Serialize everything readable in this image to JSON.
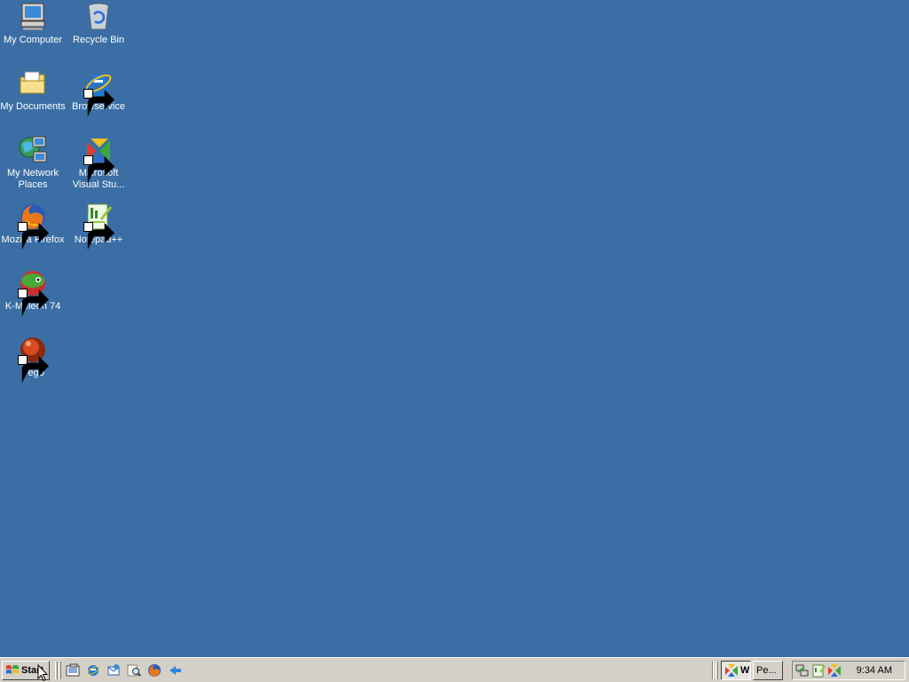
{
  "desktop": {
    "background_color": "#3a6ea5",
    "icons": [
      {
        "name": "my-computer",
        "label": "My Computer",
        "icon": "computer-icon",
        "shortcut": false
      },
      {
        "name": "recycle-bin",
        "label": "Recycle Bin",
        "icon": "recycle-bin-icon",
        "shortcut": false
      },
      {
        "name": "my-documents",
        "label": "My Documents",
        "icon": "folder-icon",
        "shortcut": false
      },
      {
        "name": "browservice",
        "label": "Browservice",
        "icon": "internet-explorer-icon",
        "shortcut": true
      },
      {
        "name": "my-network-places",
        "label": "My Network Places",
        "icon": "network-icon",
        "shortcut": false
      },
      {
        "name": "microsoft-visual-studio",
        "label": "Microsoft Visual Stu...",
        "icon": "visual-studio-icon",
        "shortcut": true
      },
      {
        "name": "mozilla-firefox",
        "label": "Mozilla Firefox",
        "icon": "firefox-icon",
        "shortcut": true
      },
      {
        "name": "notepad-plus-plus",
        "label": "Notepad++",
        "icon": "notepad-plus-plus-icon",
        "shortcut": true
      },
      {
        "name": "k-meleon",
        "label": "K-Meleon 74",
        "icon": "k-meleon-icon",
        "shortcut": true
      },
      {
        "name": "pego",
        "label": "Pego",
        "icon": "pego-icon",
        "shortcut": true
      }
    ]
  },
  "taskbar": {
    "start_label": "Start",
    "quick_launch": [
      "show-desktop-icon",
      "internet-explorer-icon",
      "outlook-express-icon",
      "search-icon",
      "firefox-icon",
      "arrow-icon"
    ],
    "tasks": [
      {
        "label": "W",
        "icon": "visual-studio-icon",
        "active": true
      },
      {
        "label": "Pe...",
        "icon": "",
        "active": false
      }
    ],
    "tray_icons": [
      "network-tray-icon",
      "notepad-tray-icon",
      "visual-studio-tray-icon"
    ],
    "clock": "9:34 AM"
  }
}
